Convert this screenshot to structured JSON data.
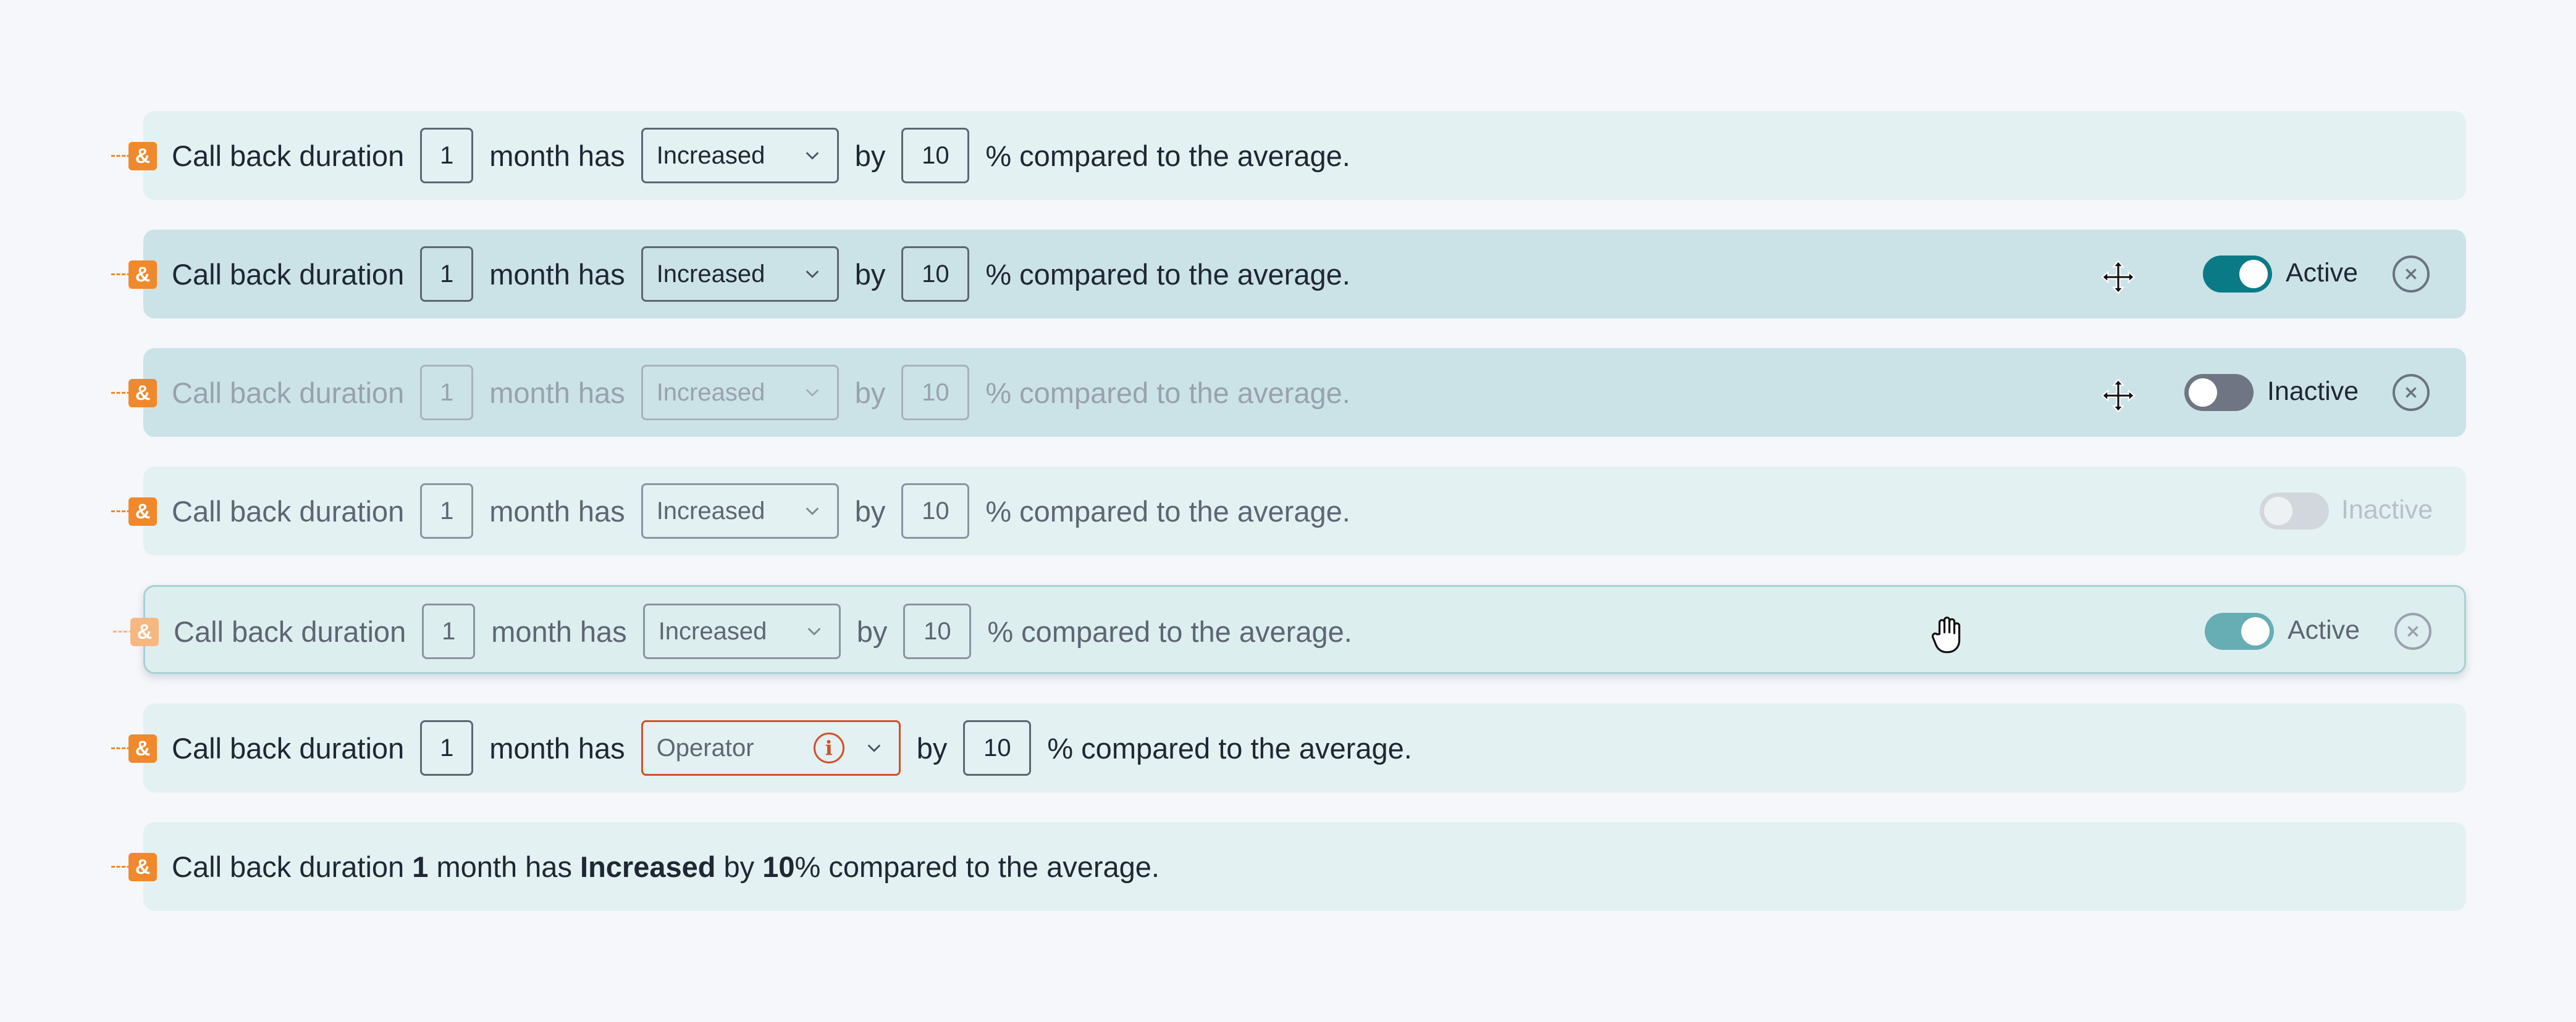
{
  "text": {
    "field": "Call back duration",
    "unit": "month has",
    "by": "by",
    "suffix": "% compared to the average.",
    "suffix_plain": "% compared to the average.",
    "amp": "&"
  },
  "values": {
    "duration": "1",
    "operator": "Increased",
    "percent": "10",
    "operator_placeholder": "Operator",
    "info_glyph": "i"
  },
  "status": {
    "active": "Active",
    "inactive": "Inactive"
  },
  "colors": {
    "accent_orange": "#f0882c",
    "toggle_on": "#0a7b86",
    "toggle_off": "#6f7582",
    "error": "#d2502b"
  },
  "icons": [
    "ampersand-icon",
    "chevron-down-icon",
    "info-icon",
    "close-icon",
    "move-icon",
    "hand-grab-icon"
  ],
  "rows": [
    {
      "state": "default"
    },
    {
      "state": "hover-active",
      "toggle": true
    },
    {
      "state": "hover-inactive",
      "toggle": false
    },
    {
      "state": "inactive-disabled",
      "toggle": false
    },
    {
      "state": "dragging",
      "toggle": true
    },
    {
      "state": "error"
    },
    {
      "state": "read-only"
    }
  ]
}
